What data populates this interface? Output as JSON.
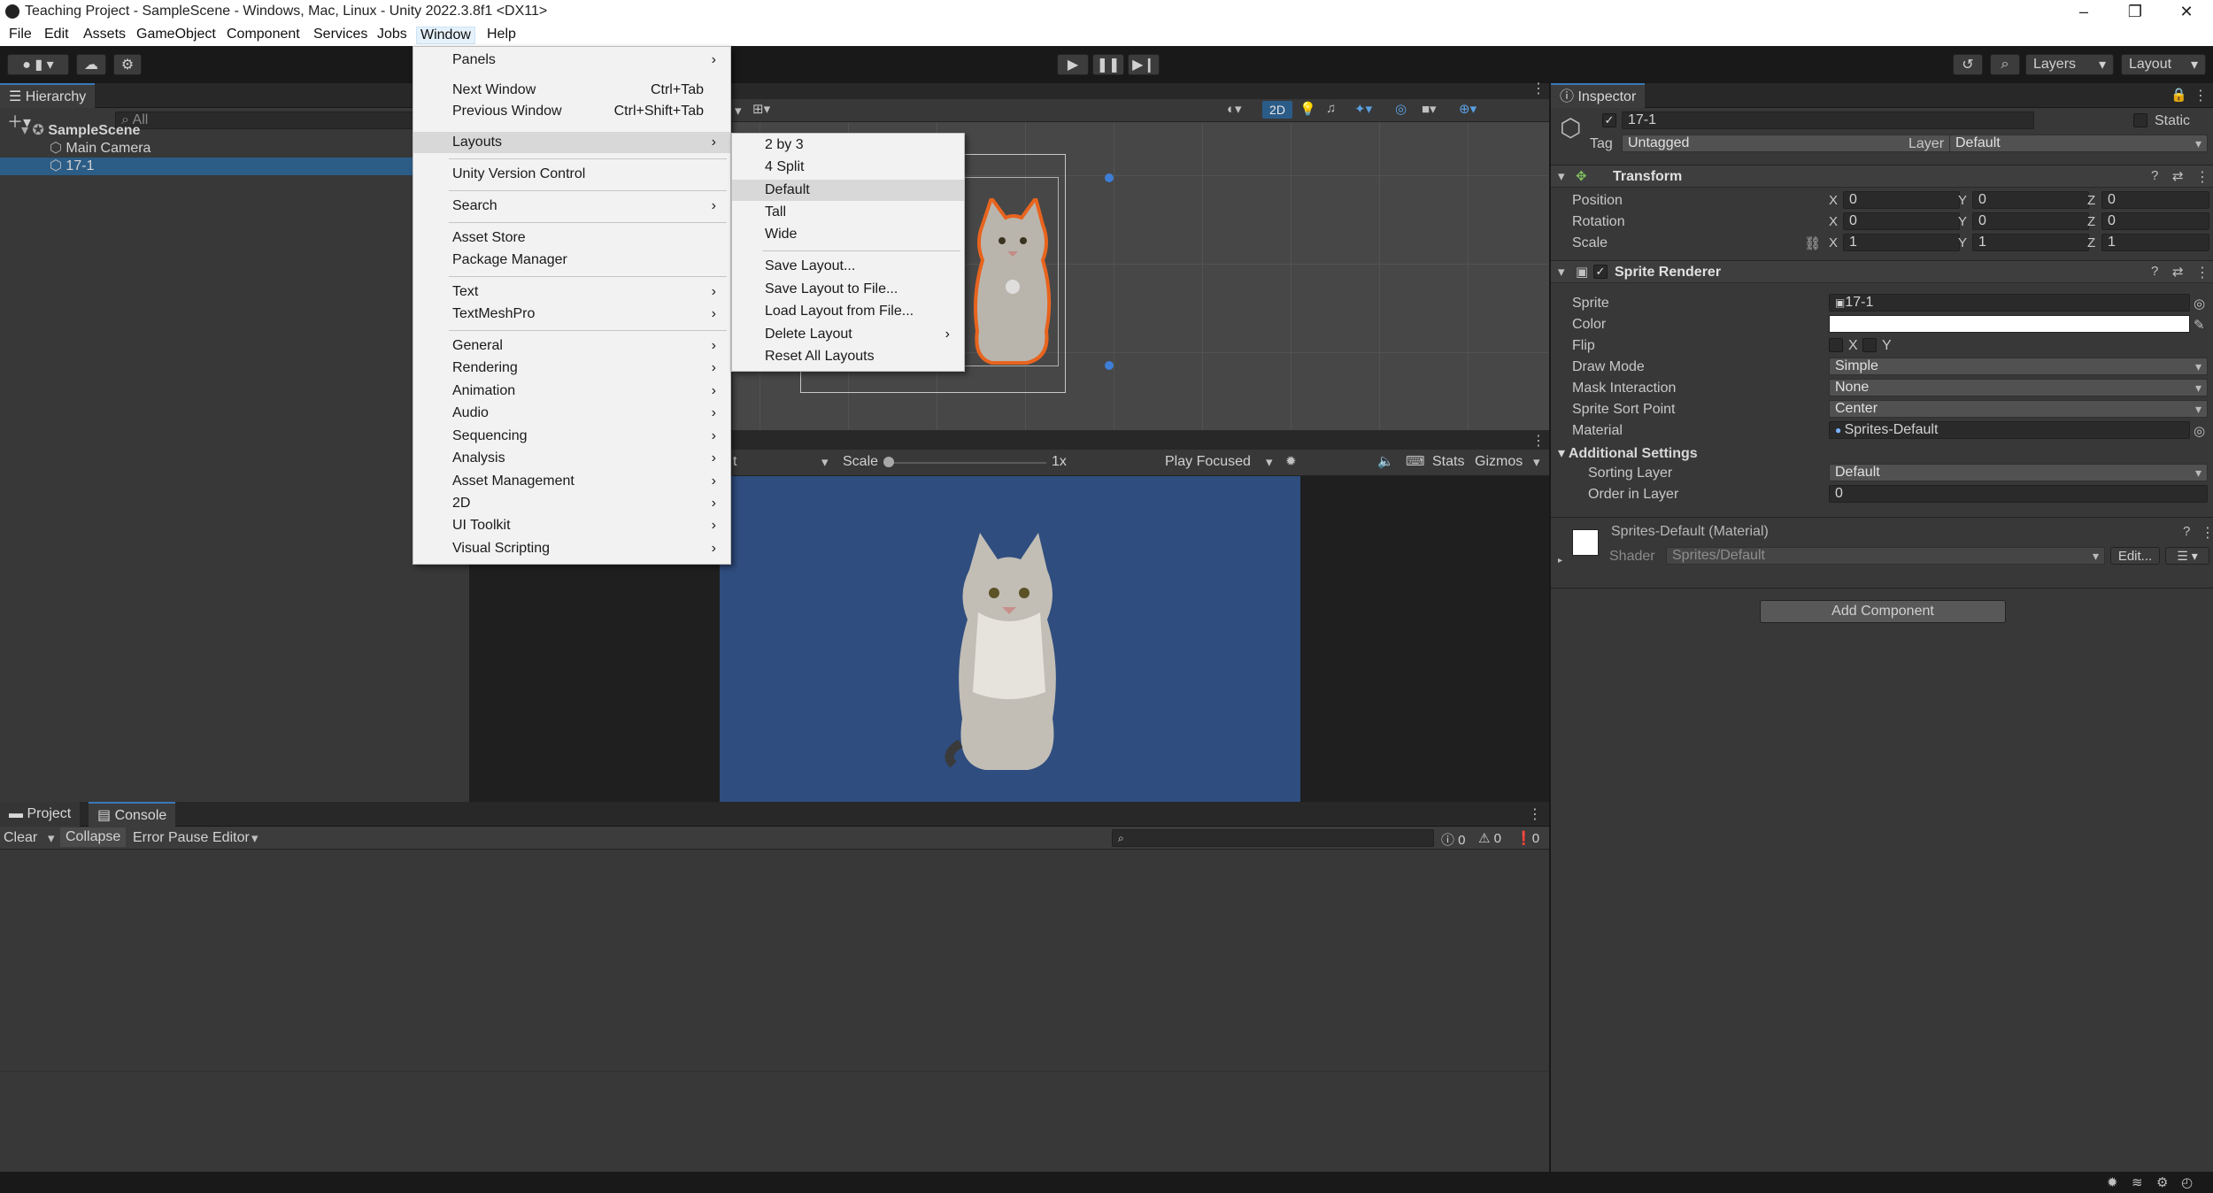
{
  "window": {
    "title": "Teaching Project - SampleScene - Windows, Mac, Linux - Unity 2022.3.8f1 <DX11>",
    "minimize": "–",
    "maximize": "❐",
    "close": "✕"
  },
  "menubar": [
    "File",
    "Edit",
    "Assets",
    "GameObject",
    "Component",
    "Services",
    "Jobs",
    "Window",
    "Help"
  ],
  "toolbar": {
    "layers": "Layers",
    "layout": "Layout"
  },
  "hierarchy": {
    "tab": "Hierarchy",
    "search_placeholder": "All",
    "scene": "SampleScene",
    "items": [
      "Main Camera",
      "17-1"
    ]
  },
  "game": {
    "display_tail": "t",
    "scale_label": "Scale",
    "scale_value": "1x",
    "play_mode": "Play Focused",
    "stats": "Stats",
    "gizmos": "Gizmos"
  },
  "scene": {
    "mode_2d": "2D"
  },
  "console": {
    "tabs": [
      "Project",
      "Console"
    ],
    "clear": "Clear",
    "collapse": "Collapse",
    "error_pause": "Error Pause",
    "editor": "Editor",
    "count_log": "0",
    "count_warn": "0",
    "count_error": "0"
  },
  "inspector": {
    "tab": "Inspector",
    "object_name": "17-1",
    "static": "Static",
    "tag_label": "Tag",
    "tag_value": "Untagged",
    "layer_label": "Layer",
    "layer_value": "Default",
    "transform": {
      "title": "Transform",
      "rows": [
        {
          "label": "Position",
          "x": "0",
          "y": "0",
          "z": "0"
        },
        {
          "label": "Rotation",
          "x": "0",
          "y": "0",
          "z": "0"
        },
        {
          "label": "Scale",
          "x": "1",
          "y": "1",
          "z": "1"
        }
      ]
    },
    "sprite_renderer": {
      "title": "Sprite Renderer",
      "sprite_label": "Sprite",
      "sprite_value": "17-1",
      "color_label": "Color",
      "flip_label": "Flip",
      "flip_x": "X",
      "flip_y": "Y",
      "draw_mode_label": "Draw Mode",
      "draw_mode_value": "Simple",
      "mask_label": "Mask Interaction",
      "mask_value": "None",
      "sort_point_label": "Sprite Sort Point",
      "sort_point_value": "Center",
      "material_label": "Material",
      "material_value": "Sprites-Default",
      "additional": "Additional Settings",
      "sorting_layer_label": "Sorting Layer",
      "sorting_layer_value": "Default",
      "order_label": "Order in Layer",
      "order_value": "0"
    },
    "material": {
      "title": "Sprites-Default (Material)",
      "shader_label": "Shader",
      "shader_value": "Sprites/Default",
      "edit": "Edit..."
    },
    "add_component": "Add Component"
  },
  "window_menu": {
    "items": [
      {
        "label": "Panels",
        "shortcut": "",
        "submenu": true
      },
      {
        "label": "Next Window",
        "shortcut": "Ctrl+Tab",
        "submenu": false
      },
      {
        "label": "Previous Window",
        "shortcut": "Ctrl+Shift+Tab",
        "submenu": false
      },
      {
        "label": "Layouts",
        "shortcut": "",
        "submenu": true
      },
      {
        "label": "Unity Version Control",
        "shortcut": "",
        "submenu": false
      },
      {
        "label": "Search",
        "shortcut": "",
        "submenu": true
      },
      {
        "label": "Asset Store",
        "shortcut": "",
        "submenu": false
      },
      {
        "label": "Package Manager",
        "shortcut": "",
        "submenu": false
      },
      {
        "label": "Text",
        "shortcut": "",
        "submenu": true
      },
      {
        "label": "TextMeshPro",
        "shortcut": "",
        "submenu": true
      },
      {
        "label": "General",
        "shortcut": "",
        "submenu": true
      },
      {
        "label": "Rendering",
        "shortcut": "",
        "submenu": true
      },
      {
        "label": "Animation",
        "shortcut": "",
        "submenu": true
      },
      {
        "label": "Audio",
        "shortcut": "",
        "submenu": true
      },
      {
        "label": "Sequencing",
        "shortcut": "",
        "submenu": true
      },
      {
        "label": "Analysis",
        "shortcut": "",
        "submenu": true
      },
      {
        "label": "Asset Management",
        "shortcut": "",
        "submenu": true
      },
      {
        "label": "2D",
        "shortcut": "",
        "submenu": true
      },
      {
        "label": "UI Toolkit",
        "shortcut": "",
        "submenu": true
      },
      {
        "label": "Visual Scripting",
        "shortcut": "",
        "submenu": true
      }
    ]
  },
  "layouts_menu": {
    "items": [
      {
        "label": "2 by 3",
        "submenu": false
      },
      {
        "label": "4 Split",
        "submenu": false
      },
      {
        "label": "Default",
        "submenu": false
      },
      {
        "label": "Tall",
        "submenu": false
      },
      {
        "label": "Wide",
        "submenu": false
      },
      {
        "label": "Save Layout...",
        "submenu": false
      },
      {
        "label": "Save Layout to File...",
        "submenu": false
      },
      {
        "label": "Load Layout from File...",
        "submenu": false
      },
      {
        "label": "Delete Layout",
        "submenu": true
      },
      {
        "label": "Reset All Layouts",
        "submenu": false
      }
    ]
  }
}
